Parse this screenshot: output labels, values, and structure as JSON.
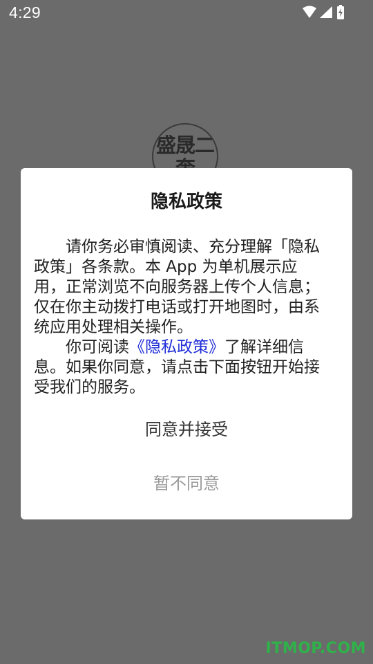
{
  "status_bar": {
    "time": "4:29",
    "icons": [
      "wifi-icon",
      "signal-icon",
      "battery-charging-icon"
    ]
  },
  "background": {
    "logo_text": "盛晟二奎"
  },
  "dialog": {
    "title": "隐私政策",
    "paragraph1": "请你务必审慎阅读、充分理解「隐私政策」各条款。本 App 为单机展示应用，正常浏览不向服务器上传个人信息；仅在你主动拨打电话或打开地图时，由系统应用处理相关操作。",
    "paragraph2_prefix": "你可阅读",
    "paragraph2_link": "《隐私政策》",
    "paragraph2_suffix": "了解详细信息。如果你同意，请点击下面按钮开始接受我们的服务。",
    "agree_label": "同意并接受",
    "decline_label": "暂不同意"
  },
  "watermark": "ITMOP.COM",
  "colors": {
    "overlay": "#6b6b6b",
    "link": "#1f2ed8",
    "decline_text": "#9a9a9a",
    "watermark": "#2fb24a"
  }
}
